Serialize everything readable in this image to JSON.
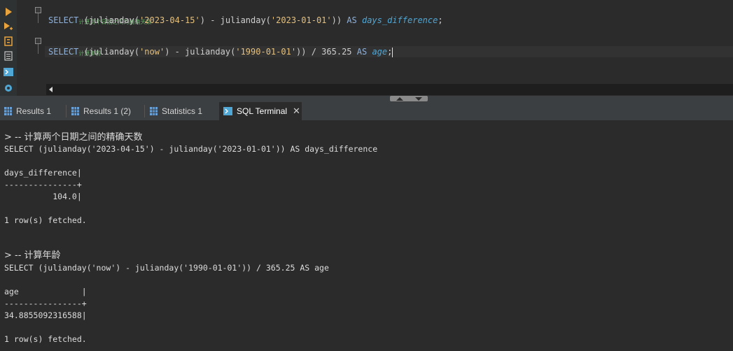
{
  "editor": {
    "comment1": "-- 计算两个日期之间的精确天数",
    "query1": {
      "select": "SELECT",
      "open": " (",
      "fn1": "julianday(",
      "d1": "'2023-04-15'",
      "mid": ") - julianday(",
      "d2": "'2023-01-01'",
      "close": "))",
      "as": " AS ",
      "alias": "days_difference",
      "end": ";"
    },
    "comment2": "-- 计算年龄",
    "query2": {
      "select": "SELECT",
      "open": " (",
      "fn1": "julianday(",
      "d1": "'now'",
      "mid": ") - julianday(",
      "d2": "'1990-01-01'",
      "close": ")) / 365.25",
      "as": " AS ",
      "alias": "age",
      "end": ";"
    }
  },
  "tabs": [
    {
      "label": "Results 1"
    },
    {
      "label": "Results 1 (2)"
    },
    {
      "label": "Statistics 1"
    },
    {
      "label": "SQL Terminal"
    }
  ],
  "terminal": {
    "lines": [
      "> -- 计算两个日期之间的精确天数",
      "SELECT (julianday('2023-04-15') - julianday('2023-01-01')) AS days_difference",
      "",
      "days_difference|",
      "---------------+",
      "          104.0|",
      "",
      "1 row(s) fetched.",
      "",
      "",
      "> -- 计算年龄",
      "SELECT (julianday('now') - julianday('1990-01-01')) / 365.25 AS age",
      "",
      "age             |",
      "----------------+",
      "34.8855092316588|",
      "",
      "1 row(s) fetched."
    ]
  },
  "colors": {
    "accent_orange": "#e8a33c",
    "accent_blue": "#4fa7d6",
    "comment_green": "#62a864"
  },
  "icons": {
    "toolbar": [
      "execute-icon",
      "execute-script-icon",
      "explain-plan-icon",
      "load-plan-icon",
      "terminal-icon",
      "settings-icon"
    ]
  }
}
